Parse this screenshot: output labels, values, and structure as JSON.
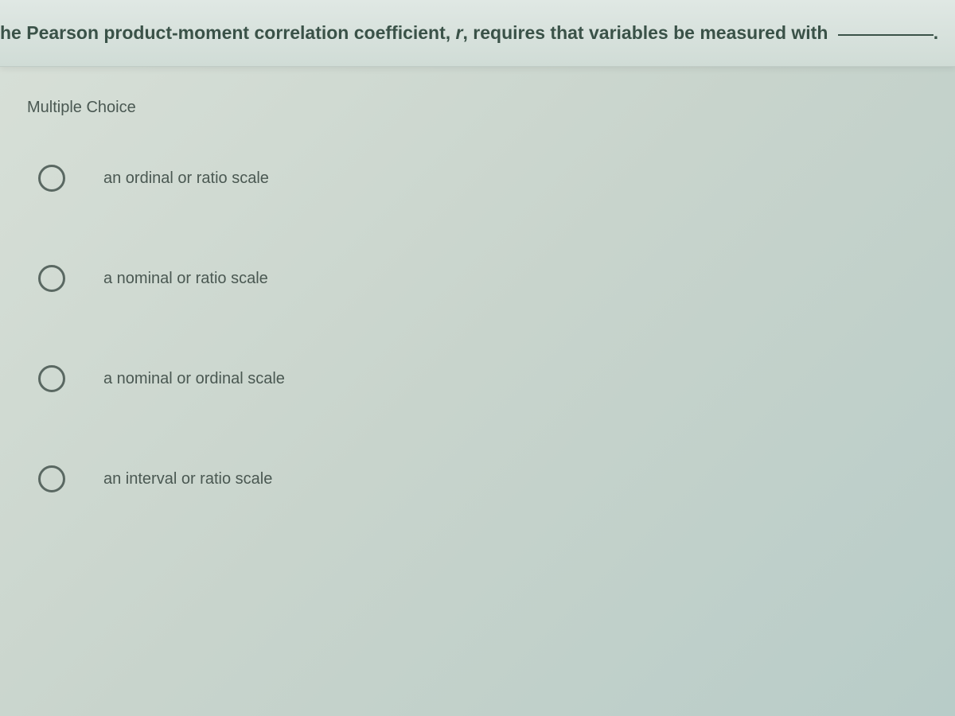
{
  "question": {
    "prefix": "he Pearson product-moment correlation coefficient, ",
    "italic": "r",
    "suffix": ", requires that variables be measured with ",
    "trailing": "."
  },
  "section_label": "Multiple Choice",
  "options": [
    {
      "label": "an ordinal or ratio scale"
    },
    {
      "label": "a nominal or ratio scale"
    },
    {
      "label": "a nominal or ordinal scale"
    },
    {
      "label": "an interval or ratio scale"
    }
  ]
}
